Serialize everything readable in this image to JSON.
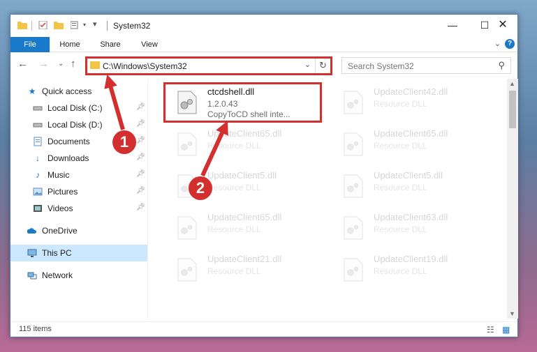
{
  "window": {
    "title": "System32"
  },
  "ribbon": {
    "tabs": [
      "File",
      "Home",
      "Share",
      "View"
    ],
    "help_icon": "?"
  },
  "address": {
    "path": "C:\\Windows\\System32",
    "search_placeholder": "Search System32"
  },
  "navigation": {
    "items": [
      {
        "label": "Quick access",
        "icon": "star-icon",
        "pinned": false
      },
      {
        "label": "Local Disk (C:)",
        "icon": "drive-icon",
        "pinned": true
      },
      {
        "label": "Local Disk (D:)",
        "icon": "drive-icon",
        "pinned": true
      },
      {
        "label": "Documents",
        "icon": "documents-icon",
        "pinned": true
      },
      {
        "label": "Downloads",
        "icon": "downloads-icon",
        "pinned": true
      },
      {
        "label": "Music",
        "icon": "music-icon",
        "pinned": true
      },
      {
        "label": "Pictures",
        "icon": "pictures-icon",
        "pinned": true
      },
      {
        "label": "Videos",
        "icon": "videos-icon",
        "pinned": true
      },
      {
        "label": "OneDrive",
        "icon": "onedrive-icon",
        "pinned": false
      },
      {
        "label": "This PC",
        "icon": "pc-icon",
        "pinned": false,
        "selected": true
      },
      {
        "label": "Network",
        "icon": "network-icon",
        "pinned": false
      }
    ]
  },
  "files": {
    "highlighted": {
      "name": "ctcdshell.dll",
      "version": "1.2.0.43",
      "description": "CopyToCD shell inte..."
    },
    "background": [
      {
        "name": "UpdateClient42.dll",
        "type": "Resource DLL"
      },
      {
        "name": "UpdateClient65.dll",
        "type": "Resource DLL"
      },
      {
        "name": "UpdateClient65.dll",
        "type": "Resource DLL"
      },
      {
        "name": "UpdateClient5.dll",
        "type": "Resource DLL"
      },
      {
        "name": "UpdateClient5.dll",
        "type": "Resource DLL"
      },
      {
        "name": "UpdateClient65.dll",
        "type": "Resource DLL"
      },
      {
        "name": "UpdateClient63.dll",
        "type": "Resource DLL"
      },
      {
        "name": "UpdateClient21.dll",
        "type": "Resource DLL"
      },
      {
        "name": "UpdateClient19.dll",
        "type": "Resource DLL"
      }
    ]
  },
  "status": {
    "item_count": "115 items"
  },
  "callouts": {
    "step1": "1",
    "step2": "2"
  },
  "colors": {
    "accent": "#1979ca",
    "highlight": "#d32f2f",
    "selected_bg": "#cce8ff"
  }
}
